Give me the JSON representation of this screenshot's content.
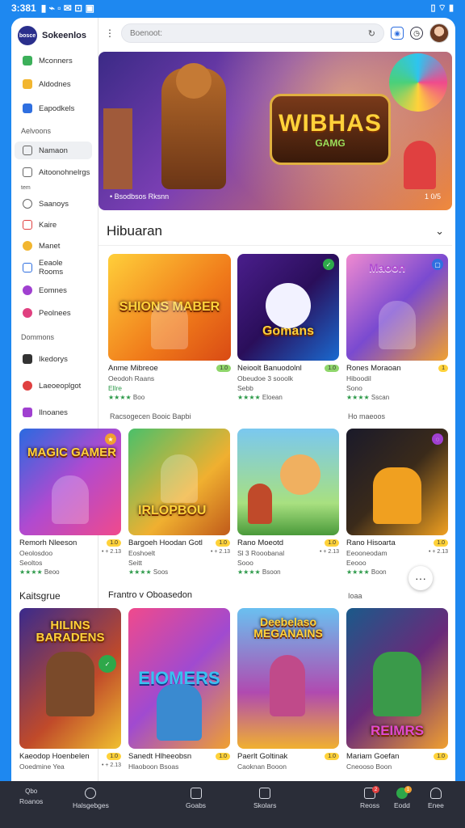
{
  "status": {
    "time": "3:381",
    "icons_left": "▮ ⌁ ▫ ✉ ⊡ ▣",
    "icons_right": "▯ ⌔ ▮"
  },
  "brand": {
    "logo": "bosce",
    "name": "Sokeenlos"
  },
  "sidebar": {
    "items": [
      {
        "label": "Mconners",
        "icon": "grid-icon",
        "color": "#3cb05a"
      },
      {
        "label": "Aldodnes",
        "icon": "star-icon",
        "color": "#f2b630"
      },
      {
        "label": "Eapodkels",
        "icon": "puzzle-icon",
        "color": "#2f6fe0"
      }
    ],
    "section1": "Aelvoons",
    "items2": [
      {
        "label": "Namaon",
        "icon": "window-icon",
        "color": "#666",
        "active": true
      },
      {
        "label": "Aitoonohnelrgs",
        "icon": "square-icon",
        "color": "#666"
      }
    ],
    "section2": "tem",
    "items3": [
      {
        "label": "Saanoys",
        "icon": "heart-icon",
        "color": "#666"
      },
      {
        "label": "Kaire",
        "icon": "box-icon",
        "color": "#e04040"
      },
      {
        "label": "Manet",
        "icon": "flower-icon",
        "color": "#f2b630"
      },
      {
        "label": "Eeaole Rooms",
        "icon": "book-icon",
        "color": "#2f6fe0"
      },
      {
        "label": "Eomnes",
        "icon": "game-icon",
        "color": "#a040d0"
      },
      {
        "label": "Peolnees",
        "icon": "circle-icon",
        "color": "#e04080"
      }
    ],
    "section3": "Dommons",
    "items4": [
      {
        "label": "Ikedorys",
        "icon": "flag-icon",
        "color": "#333"
      },
      {
        "label": "Laeoeoplgot",
        "icon": "people-icon",
        "color": "#e04040"
      },
      {
        "label": "Ilnoanes",
        "icon": "layers-icon",
        "color": "#a040d0"
      }
    ]
  },
  "search": {
    "placeholder": "Boenoot:"
  },
  "hero": {
    "title": "WIBHAS",
    "subtitle": "GAMG",
    "caption": "• Bsodbsos Rksnn",
    "counter": "1 0/5"
  },
  "section": {
    "title": "Hibuaran"
  },
  "row1": [
    {
      "title": "Anme Mibreoe",
      "tag": "",
      "pill": "1.0",
      "sub": "Oeodoh Raans",
      "sub2": "Ellre",
      "stars": "★★★★",
      "count": "Boo",
      "art": "SHIONS MABER",
      "bg": "linear-gradient(135deg,#ffcf3a,#f07a1a 60%,#d94a14)"
    },
    {
      "title": "Neioolt Banuodolnl",
      "tag": "",
      "pill": "1.0",
      "sub": "Obeudoe 3 sooolk",
      "sub2": "Sebb",
      "stars": "★★★★",
      "count": "Eloean",
      "art": "Gomans",
      "bg": "linear-gradient(135deg,#4a1e8c,#2a0e5a 50%,#1a6ad0)"
    },
    {
      "title": "Rones Moraoan",
      "tag": "",
      "pill": "1",
      "sub": "Hiboodil",
      "sub2": "Sono",
      "stars": "★★★★",
      "count": "Sscan",
      "art": "Maoon",
      "bg": "linear-gradient(135deg,#f08ad0,#7a4ad0 50%,#f0a030)"
    }
  ],
  "notes1": [
    "Racsogecen Booic Bapbi",
    "Ho maeoos"
  ],
  "row2": [
    {
      "title": "Remorh Nleeson",
      "pill": "1.0",
      "sub": "Oeolosdoo",
      "sub2": "Seoltos",
      "right": "• + 2.13",
      "stars": "★★★★",
      "count": "Beoo",
      "art": "MAGIC GAMER",
      "bg": "linear-gradient(135deg,#2a6ae0,#b04ad0 50%,#f04a8c)"
    },
    {
      "title": "Bargoeh Hoodan Gotl",
      "pill": "1.0",
      "sub": "Eoshoelt",
      "sub2": "Seitt",
      "right": "• + 2.13",
      "stars": "★★★★",
      "count": "Soos",
      "art": "IRLOPBOU",
      "bg": "linear-gradient(135deg,#4ac06a,#f0b030 60%,#c05a1a)"
    },
    {
      "title": "Rano Moeotd",
      "pill": "1.0",
      "sub": "Sl 3 Rooobanal",
      "sub2": "Sooo",
      "right": "• + 2.13",
      "stars": "★★★★",
      "count": "Bsoon",
      "art": "",
      "bg": "linear-gradient(180deg,#7ac8f0,#a8e080 70%,#4a9a3a)"
    },
    {
      "title": "Rano Hisoarta",
      "pill": "1.0",
      "sub": "Eeooneodam",
      "sub2": "Eeooo",
      "right": "• + 2.13",
      "stars": "★★★★",
      "count": "Boon",
      "art": "",
      "bg": "linear-gradient(135deg,#1a1a2a,#3a2a1a 50%,#f0a020)"
    }
  ],
  "labels": {
    "left": "Kaitsgrue",
    "mid": "Frantro v Oboasedon",
    "right": "Ioaa"
  },
  "row3": [
    {
      "title": "Kaeodop Hoenbelen",
      "pill": "1.0",
      "sub": "Ooedmine Yea",
      "right": "• + 2.13",
      "art": "HILINS BARADENS",
      "bg": "linear-gradient(135deg,#3a2a8c,#c04a2a 60%,#f0c030)"
    },
    {
      "title": "Sanedt Hlheeobsn",
      "pill": "1.0",
      "sub": "Hlaoboon Bsoas",
      "right": "",
      "art": "EIOMERS",
      "bg": "linear-gradient(135deg,#f04a8c,#a04ad0 50%,#f0a030)"
    },
    {
      "title": "Paerlt Goltinak",
      "pill": "1.0",
      "sub": "Caoknan Booon",
      "right": "",
      "art": "Deebelaso MEGANAINS",
      "bg": "linear-gradient(180deg,#6ac0f0,#b04ab0 60%,#f0b030)"
    },
    {
      "title": "Mariam Goefan",
      "pill": "1.0",
      "sub": "Cneooso Boon",
      "right": "",
      "art": "REIMRS",
      "bg": "linear-gradient(135deg,#1a5a8a,#6a2a7a 50%,#f0a030)"
    }
  ],
  "bottom_nav": [
    {
      "label": "Roanos",
      "top": "Qbo"
    },
    {
      "label": "Halsgebges"
    },
    {
      "label": "Goabs"
    },
    {
      "label": "Skolars"
    },
    {
      "label": "Reoss",
      "badge": "2"
    },
    {
      "label": "Eodd",
      "badge": "1"
    },
    {
      "label": "Enee"
    }
  ]
}
